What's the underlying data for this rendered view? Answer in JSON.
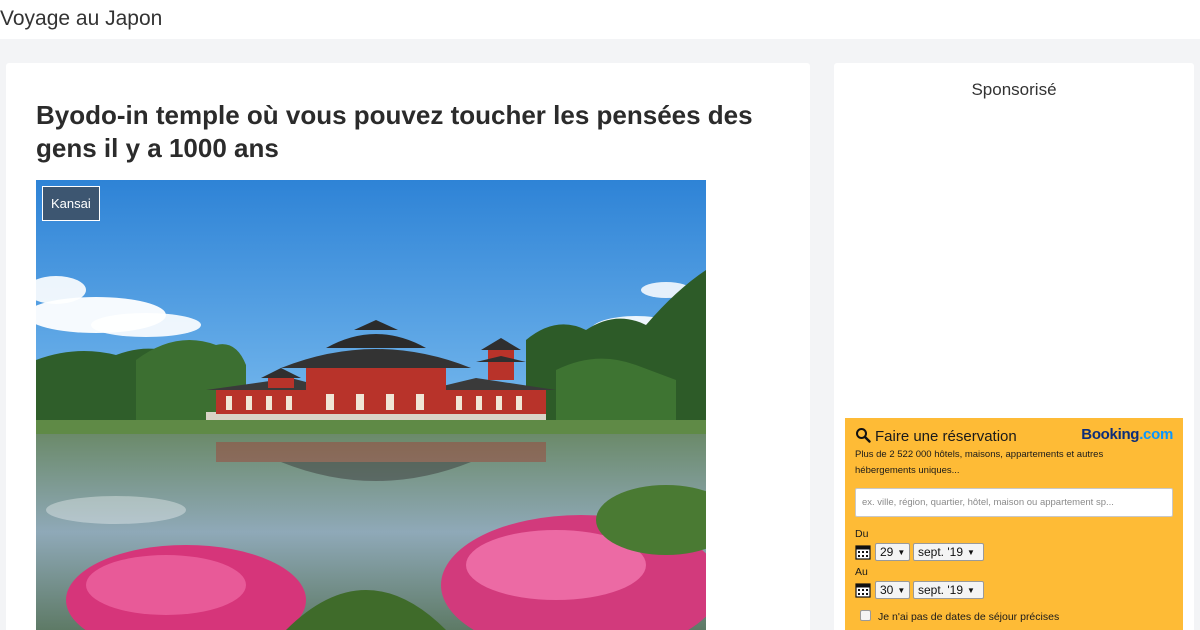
{
  "header": {
    "site_title": "Voyage au Japon"
  },
  "article": {
    "title": "Byodo-in temple où vous pouvez toucher les pensées des gens il y a 1000 ans",
    "category_badge": "Kansai",
    "image_alt": "Byodo-in temple reflected in pond with pink azaleas"
  },
  "sidebar": {
    "sponsored_label": "Sponsorisé",
    "booking_widget": {
      "title": "Faire une réservation",
      "logo_part1": "Booking",
      "logo_part2": ".com",
      "description": "Plus de 2 522 000 hôtels, maisons, appartements et autres hébergements uniques...",
      "search_placeholder": "ex. ville, région, quartier, hôtel, maison ou appartement sp...",
      "checkin_label": "Du",
      "checkin_day": "29",
      "checkin_month": "sept. '19",
      "checkout_label": "Au",
      "checkout_day": "30",
      "checkout_month": "sept. '19",
      "no_dates_label": "Je n'ai pas de dates de séjour précises",
      "colors": {
        "background": "#febb36",
        "logo_dark": "#0b2d7a",
        "logo_light": "#0896ff"
      }
    }
  }
}
